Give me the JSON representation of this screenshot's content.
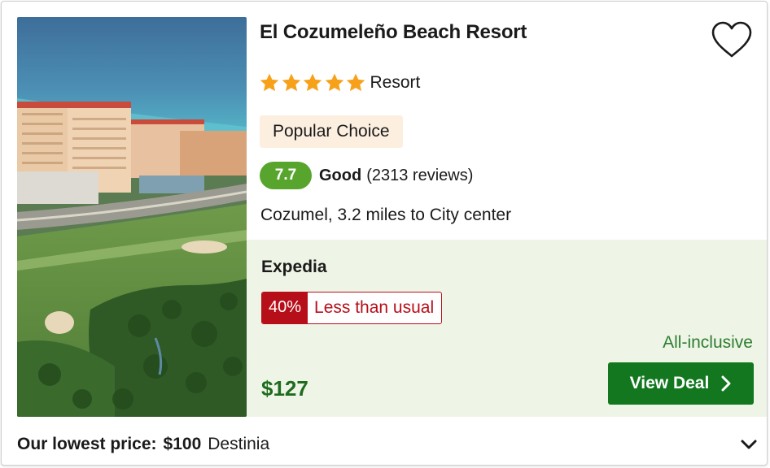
{
  "hotel": {
    "name": "El Cozumeleño Beach Resort",
    "star_rating": 5,
    "property_type": "Resort",
    "badge": "Popular Choice",
    "score": "7.7",
    "score_word": "Good",
    "reviews": "(2313 reviews)",
    "location": "Cozumel, 3.2 miles to City center"
  },
  "deal": {
    "provider": "Expedia",
    "discount_pct": "40%",
    "discount_label": "Less than usual",
    "plan": "All-inclusive",
    "price": "$127",
    "cta_label": "View Deal"
  },
  "footer": {
    "lowest_label": "Our lowest price:",
    "lowest_price": "$100",
    "lowest_provider": "Destinia"
  },
  "colors": {
    "star": "#f7a11a",
    "score_bg": "#58a52d",
    "badge_bg": "#fcefe0",
    "deal_bg": "#eef5e6",
    "discount": "#b70f1a",
    "cta_bg": "#12771f",
    "price": "#1f6b1f"
  },
  "icons": {
    "favorite": "heart-outline-icon",
    "star": "star-icon",
    "cta": "chevron-right-icon",
    "expand": "chevron-down-icon"
  }
}
